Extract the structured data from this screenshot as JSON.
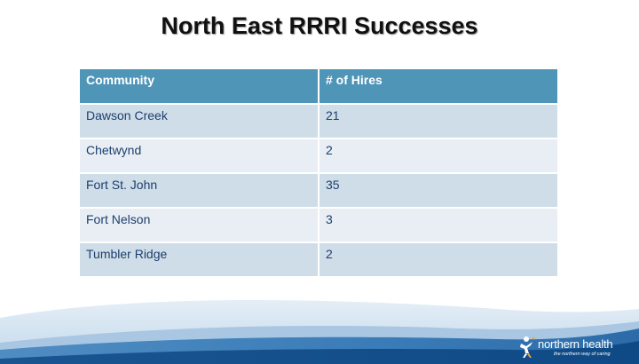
{
  "slide": {
    "title": "North East RRRI Successes"
  },
  "table": {
    "headers": [
      "Community",
      "# of Hires"
    ],
    "rows": [
      {
        "community": "Dawson Creek",
        "hires": "21"
      },
      {
        "community": "Chetwynd",
        "hires": "2"
      },
      {
        "community": "Fort St. John",
        "hires": "35"
      },
      {
        "community": "Fort Nelson",
        "hires": "3"
      },
      {
        "community": "Tumbler Ridge",
        "hires": "2"
      }
    ]
  },
  "brand": {
    "name": "northern health",
    "tagline": "the northern way of caring",
    "icon": "person-figure-icon"
  },
  "colors": {
    "header_bg": "#4f95b8",
    "row_dark": "#cfdde8",
    "row_light": "#e8eef4",
    "cell_text": "#1d3f6e",
    "wave_blue": "#1d5d96"
  }
}
